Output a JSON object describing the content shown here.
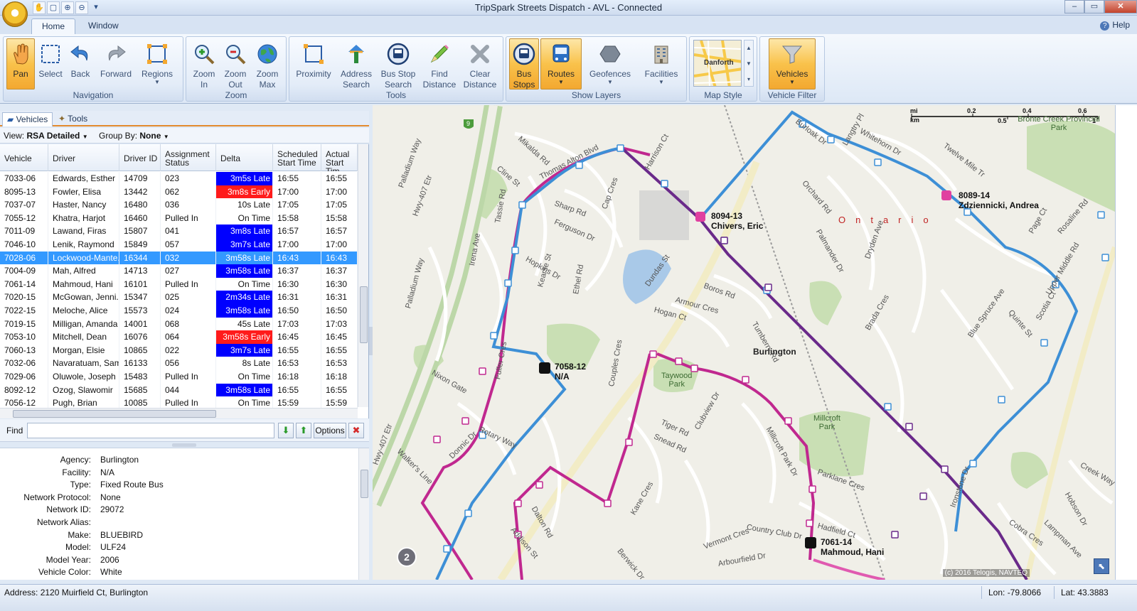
{
  "window": {
    "title": "TripSpark Streets Dispatch - AVL - Connected",
    "controls": {
      "minimize": "–",
      "maximize": "▭",
      "close": "✕"
    }
  },
  "quick_access": [
    "✋",
    "▢",
    "⊕",
    "⊖",
    "▾"
  ],
  "ribbon_tabs": [
    "Home",
    "Window"
  ],
  "help_label": "Help",
  "ribbon": {
    "navigation": {
      "label": "Navigation",
      "pan": "Pan",
      "select": "Select",
      "back": "Back",
      "forward": "Forward",
      "regions": "Regions"
    },
    "zoom": {
      "label": "Zoom",
      "zoom_in": "Zoom\nIn",
      "zoom_out": "Zoom\nOut",
      "zoom_max": "Zoom\nMax"
    },
    "tools": {
      "label": "Tools",
      "proximity": "Proximity",
      "address_search": "Address\nSearch",
      "bus_stop_search": "Bus Stop\nSearch",
      "find_distance": "Find\nDistance",
      "clear_distance": "Clear\nDistance"
    },
    "show_layers": {
      "label": "Show Layers",
      "bus_stops": "Bus\nStops",
      "routes": "Routes",
      "geofences": "Geofences",
      "facilities": "Facilities"
    },
    "map_style": {
      "label": "Map Style",
      "thumb_text": "Danforth"
    },
    "vehicle_filter": {
      "label": "Vehicle Filter",
      "vehicles": "Vehicles"
    }
  },
  "pane_tabs": {
    "vehicles": "Vehicles",
    "tools": "Tools"
  },
  "view_bar": {
    "view_label": "View:",
    "view_value": "RSA Detailed",
    "group_label": "Group By:",
    "group_value": "None"
  },
  "grid": {
    "columns": [
      "Vehicle",
      "Driver",
      "Driver ID",
      "Assignment\nStatus",
      "Delta",
      "Scheduled\nStart Time",
      "Actual\nStart Tim"
    ],
    "rows": [
      {
        "vehicle": "7033-06",
        "driver": "Edwards, Esther",
        "driver_id": "14709",
        "status": "023",
        "delta": "3m5s Late",
        "delta_type": "late",
        "sched": "16:55",
        "actual": "16:55"
      },
      {
        "vehicle": "8095-13",
        "driver": "Fowler, Elisa",
        "driver_id": "13442",
        "status": "062",
        "delta": "3m8s Early",
        "delta_type": "early",
        "sched": "17:00",
        "actual": "17:00"
      },
      {
        "vehicle": "7037-07",
        "driver": "Haster, Nancy",
        "driver_id": "16480",
        "status": "036",
        "delta": "10s Late",
        "delta_type": "none",
        "sched": "17:05",
        "actual": "17:05"
      },
      {
        "vehicle": "7055-12",
        "driver": "Khatra, Harjot",
        "driver_id": "16460",
        "status": "Pulled In",
        "delta": "On Time",
        "delta_type": "none",
        "sched": "15:58",
        "actual": "15:58"
      },
      {
        "vehicle": "7011-09",
        "driver": "Lawand, Firas",
        "driver_id": "15807",
        "status": "041",
        "delta": "3m8s Late",
        "delta_type": "late",
        "sched": "16:57",
        "actual": "16:57"
      },
      {
        "vehicle": "7046-10",
        "driver": "Lenik, Raymond",
        "driver_id": "15849",
        "status": "057",
        "delta": "3m7s Late",
        "delta_type": "late",
        "sched": "17:00",
        "actual": "17:00"
      },
      {
        "vehicle": "7028-06",
        "driver": "Lockwood-Mante...",
        "driver_id": "16344",
        "status": "032",
        "delta": "3m58s Late",
        "delta_type": "selected",
        "sched": "16:43",
        "actual": "16:43"
      },
      {
        "vehicle": "7004-09",
        "driver": "Mah, Alfred",
        "driver_id": "14713",
        "status": "027",
        "delta": "3m58s Late",
        "delta_type": "late",
        "sched": "16:37",
        "actual": "16:37"
      },
      {
        "vehicle": "7061-14",
        "driver": "Mahmoud, Hani",
        "driver_id": "16101",
        "status": "Pulled In",
        "delta": "On Time",
        "delta_type": "none",
        "sched": "16:30",
        "actual": "16:30"
      },
      {
        "vehicle": "7020-15",
        "driver": "McGowan, Jenni...",
        "driver_id": "15347",
        "status": "025",
        "delta": "2m34s Late",
        "delta_type": "late",
        "sched": "16:31",
        "actual": "16:31"
      },
      {
        "vehicle": "7022-15",
        "driver": "Meloche, Alice",
        "driver_id": "15573",
        "status": "024",
        "delta": "3m58s Late",
        "delta_type": "late",
        "sched": "16:50",
        "actual": "16:50"
      },
      {
        "vehicle": "7019-15",
        "driver": "Milligan, Amanda",
        "driver_id": "14001",
        "status": "068",
        "delta": "45s Late",
        "delta_type": "none",
        "sched": "17:03",
        "actual": "17:03"
      },
      {
        "vehicle": "7053-10",
        "driver": "Mitchell, Dean",
        "driver_id": "16076",
        "status": "064",
        "delta": "3m58s Early",
        "delta_type": "early",
        "sched": "16:45",
        "actual": "16:45"
      },
      {
        "vehicle": "7060-13",
        "driver": "Morgan, Elsie",
        "driver_id": "10865",
        "status": "022",
        "delta": "3m7s Late",
        "delta_type": "late",
        "sched": "16:55",
        "actual": "16:55"
      },
      {
        "vehicle": "7032-06",
        "driver": "Navaratuam, Sam",
        "driver_id": "16133",
        "status": "056",
        "delta": "8s Late",
        "delta_type": "none",
        "sched": "16:53",
        "actual": "16:53"
      },
      {
        "vehicle": "7029-06",
        "driver": "Oluwole, Joseph",
        "driver_id": "15483",
        "status": "Pulled In",
        "delta": "On Time",
        "delta_type": "none",
        "sched": "16:18",
        "actual": "16:18"
      },
      {
        "vehicle": "8092-12",
        "driver": "Ozog, Slawomir",
        "driver_id": "15685",
        "status": "044",
        "delta": "3m58s Late",
        "delta_type": "late",
        "sched": "16:55",
        "actual": "16:55"
      },
      {
        "vehicle": "7056-12",
        "driver": "Pugh, Brian",
        "driver_id": "10085",
        "status": "Pulled In",
        "delta": "On Time",
        "delta_type": "none",
        "sched": "15:59",
        "actual": "15:59"
      }
    ]
  },
  "find": {
    "label": "Find",
    "value": "",
    "options_label": "Options",
    "down_icon": "⬇",
    "up_icon": "⬆",
    "clear_icon": "✖"
  },
  "details": [
    {
      "k": "Agency:",
      "v": "Burlington"
    },
    {
      "k": "Facility:",
      "v": "N/A"
    },
    {
      "k": "Type:",
      "v": "Fixed Route Bus"
    },
    {
      "k": "Network Protocol:",
      "v": "None"
    },
    {
      "k": "Network ID:",
      "v": "29072"
    },
    {
      "k": "Network Alias:",
      "v": ""
    },
    {
      "k": "Make:",
      "v": "BLUEBIRD"
    },
    {
      "k": "Model:",
      "v": "ULF24"
    },
    {
      "k": "Model Year:",
      "v": "2006"
    },
    {
      "k": "Vehicle Color:",
      "v": "White"
    }
  ],
  "map": {
    "vehicles": [
      {
        "id": "8094-13",
        "name": "Chivers, Eric"
      },
      {
        "id": "8089-14",
        "name": "Zdziennicki, Andrea"
      },
      {
        "id": "7058-12",
        "name": "N/A"
      },
      {
        "id": "7061-14",
        "name": "Mahmoud, Hani"
      }
    ],
    "places": {
      "burlington": "Burlington",
      "ontario": "Ontario",
      "taywood": "Taywood\nPark",
      "millcroft": "Millcroft\nPark",
      "bronte": "Bronte Creek Provincial\nPark"
    },
    "streets": [
      "Burloak Dr",
      "Whitehorn Dr",
      "Mikalda Rd",
      "Cline St",
      "Thomas Alton Blvd",
      "Harrison Ct",
      "Langtry Pl",
      "Twelve Mile Tr",
      "Orchard Rd",
      "Sharp Rd",
      "Ferguson Dr",
      "Palladium Way",
      "Tassie Rd",
      "Cap Cres",
      "Irena Ave",
      "Hopkins Dr",
      "Dundas St",
      "Boros Rd",
      "Armour Cres",
      "Hogan Ct",
      "Kearse St",
      "Ethel Rd",
      "Palladium Way",
      "Tumberry Rd",
      "Dryden Ave",
      "Quinte St",
      "Scotia Ct",
      "Upper Middle Rd",
      "Blue Spruce Ave",
      "Brada Cres",
      "Millcroft Park Dr",
      "Fuller Cres",
      "Nixon Gate",
      "Rotary Way",
      "Couples Cres",
      "Tiger Rd",
      "Snead Rd",
      "Clubview Dr",
      "Walker's Line",
      "Donnic Dr",
      "Dalton Rd",
      "Addison St",
      "Kane Cres",
      "Berwick Dr",
      "Parklane Cres",
      "Country Club Dr",
      "Hadfield Ct",
      "Vermont Cres",
      "Arbourfield Dr",
      "Ironstone Dr",
      "Cobra Cres",
      "Lampman Ave",
      "Hobson Dr",
      "Creek Way",
      "Hwy-407 Etr",
      "Page Ct",
      "Rosaline Rd",
      "Palmander Dr",
      "Hwy-407 Etr"
    ],
    "cluster_count": "2",
    "scale": {
      "units_top": "mi",
      "units_bottom": "km",
      "ticks_top": [
        "0.2",
        "0.4",
        "0.6"
      ],
      "ticks_bottom": [
        "0.5",
        "1"
      ]
    },
    "copyright": "(c) 2016 Telogis, NAVTEQ",
    "highway_shield": "9"
  },
  "status": {
    "address": "Address: 2120 Muirfield Ct, Burlington",
    "lon": "Lon: -79.8066",
    "lat": "Lat: 43.3883"
  },
  "colors": {
    "late": "#0000ff",
    "early": "#ff1b1b",
    "selected": "#3399ff",
    "route_blue": "#3d8fd6",
    "route_magenta": "#c0288f",
    "route_purple": "#6a2a8a"
  }
}
